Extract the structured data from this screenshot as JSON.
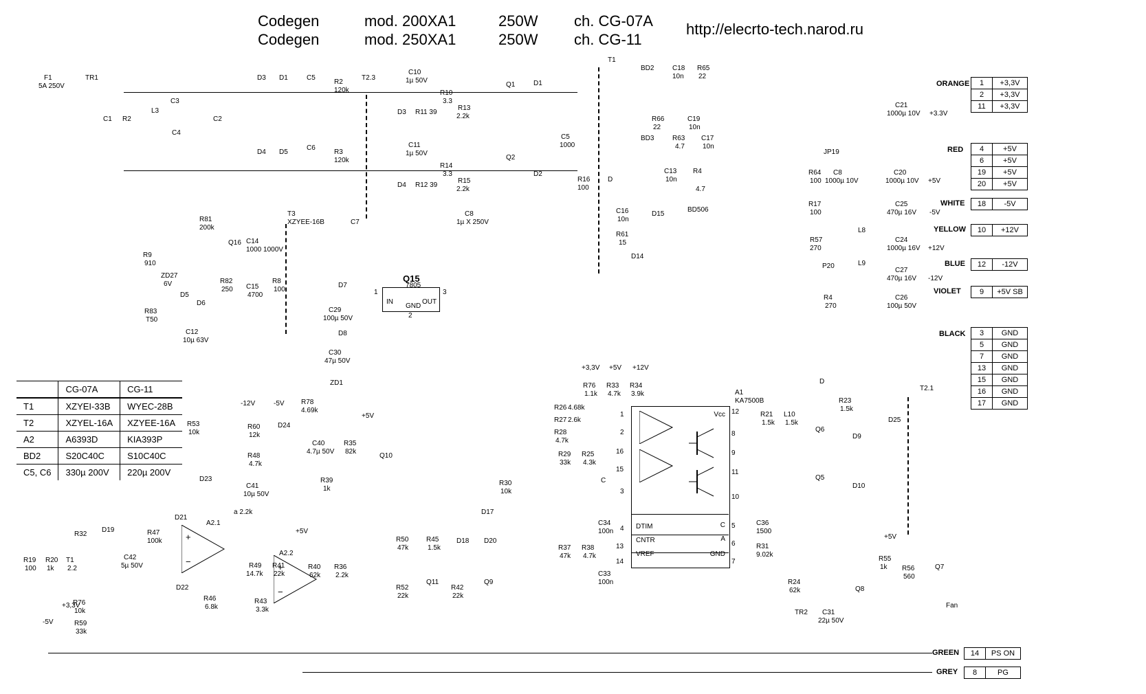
{
  "header": {
    "l1_a": "Codegen",
    "l1_b": "mod. 200XA1",
    "l1_c": "250W",
    "l1_d": "ch. CG-07A",
    "l2_a": "Codegen",
    "l2_b": "mod. 250XA1",
    "l2_c": "250W",
    "l2_d": "ch. CG-11",
    "url": "http://elecrto-tech.narod.ru"
  },
  "outputs": {
    "orange": {
      "label": "ORANGE",
      "pins": [
        {
          "n": "1",
          "v": "+3,3V"
        },
        {
          "n": "2",
          "v": "+3,3V"
        },
        {
          "n": "11",
          "v": "+3,3V"
        }
      ]
    },
    "red": {
      "label": "RED",
      "pins": [
        {
          "n": "4",
          "v": "+5V"
        },
        {
          "n": "6",
          "v": "+5V"
        },
        {
          "n": "19",
          "v": "+5V"
        },
        {
          "n": "20",
          "v": "+5V"
        }
      ]
    },
    "white": {
      "label": "WHITE",
      "pins": [
        {
          "n": "18",
          "v": "-5V"
        }
      ]
    },
    "yellow": {
      "label": "YELLOW",
      "pins": [
        {
          "n": "10",
          "v": "+12V"
        }
      ]
    },
    "blue": {
      "label": "BLUE",
      "pins": [
        {
          "n": "12",
          "v": "-12V"
        }
      ]
    },
    "violet": {
      "label": "VIOLET",
      "pins": [
        {
          "n": "9",
          "v": "+5V SB"
        }
      ]
    },
    "black": {
      "label": "BLACK",
      "pins": [
        {
          "n": "3",
          "v": "GND"
        },
        {
          "n": "5",
          "v": "GND"
        },
        {
          "n": "7",
          "v": "GND"
        },
        {
          "n": "13",
          "v": "GND"
        },
        {
          "n": "15",
          "v": "GND"
        },
        {
          "n": "16",
          "v": "GND"
        },
        {
          "n": "17",
          "v": "GND"
        }
      ]
    },
    "green": {
      "label": "GREEN",
      "pins": [
        {
          "n": "14",
          "v": "PS ON"
        }
      ]
    },
    "grey": {
      "label": "GREY",
      "pins": [
        {
          "n": "8",
          "v": "PG"
        }
      ]
    }
  },
  "variant_table": {
    "cols": [
      "",
      "CG-07A",
      "CG-11"
    ],
    "rows": [
      [
        "T1",
        "XZYEI-33B",
        "WYEC-28B"
      ],
      [
        "T2",
        "XZYEL-16A",
        "XZYEE-16A"
      ],
      [
        "A2",
        "A6393D",
        "KIA393P"
      ],
      [
        "BD2",
        "S20C40C",
        "S10C40C"
      ],
      [
        "C5, C6",
        "330µ 200V",
        "220µ 200V"
      ]
    ]
  },
  "ic": {
    "q15": {
      "name": "Q15",
      "part": "7805",
      "p1": "1",
      "p2": "2",
      "p3": "3",
      "in": "IN",
      "gnd": "GND",
      "out": "OUT"
    },
    "a1": {
      "name": "A1",
      "part": "KA7500B",
      "left": [
        "1",
        "2",
        "16",
        "15",
        "3",
        "4",
        "13",
        "14"
      ],
      "right": [
        "12",
        "8",
        "9",
        "11",
        "10",
        "5",
        "6",
        "7"
      ],
      "labels_left": [
        "DTIM",
        "CNTR",
        "VREF"
      ],
      "labels_right": [
        "Vcc",
        "C",
        "A",
        "GND"
      ]
    },
    "a2_1": "A2.1",
    "a2_2": "A2.2"
  },
  "refs": {
    "F1": "F1",
    "F1v": "5A 250V",
    "TR1": "TR1",
    "L3": "L3",
    "C1": "C1",
    "C2": "C2",
    "C3": "C3",
    "C4": "C4",
    "R2": "R2",
    "D3": "D3",
    "D4": "D4",
    "D1": "D1",
    "D5": "D5",
    "C5": "C5",
    "C6": "C6",
    "R2b": "R2",
    "R2bv": "120k",
    "R3": "R3",
    "R3v": "120k",
    "T23": "T2.3",
    "C10": "C10",
    "C10v": "1µ 50V",
    "D3b": "D3",
    "R11": "R11 39",
    "R10": "R10",
    "R10v": "3.3",
    "R13": "R13",
    "R13v": "2.2k",
    "Q1": "Q1",
    "D1b": "D1",
    "C11": "C11",
    "C11v": "1µ 50V",
    "D4b": "D4",
    "R12": "R12 39",
    "R14": "R14",
    "R14v": "3.3",
    "R15": "R15",
    "R15v": "2.2k",
    "Q2": "Q2",
    "D2": "D2",
    "C5b": "C5",
    "C5bv": "1000",
    "R16": "R16",
    "R16v": "100",
    "C8p": "C8",
    "C8pv": "1µ X 250V",
    "C7": "C7",
    "T1": "T1",
    "BD2": "BD2",
    "C18": "C18",
    "C18v": "10n",
    "R65": "R65",
    "R65v": "22",
    "R66": "R66",
    "R66v": "22",
    "C19": "C19",
    "C19v": "10n",
    "BD3": "BD3",
    "R63": "R63",
    "R63v": "4.7",
    "C17": "C17",
    "C17v": "10n",
    "C13": "C13",
    "C13v": "10n",
    "R4b": "R4",
    "R4bv": "4.7",
    "D": "D",
    "C16": "C16",
    "C16v": "10n",
    "R61": "R61",
    "R61v": "15",
    "D15": "D15",
    "BD506": "BD506",
    "D14": "D14",
    "JP19": "JP19",
    "R64": "R64",
    "R64v": "100",
    "C8": "C8",
    "C8v": "1000µ 10V",
    "C20": "C20",
    "C20v": "1000µ 10V",
    "p5": "+5V",
    "C21": "C21",
    "C21v": "1000µ 10V",
    "p33": "+3.3V",
    "R17": "R17",
    "R17v": "100",
    "C25": "C25",
    "C25v": "470µ 16V",
    "m5": "-5V",
    "L8": "L8",
    "R57": "R57",
    "R57v": "270",
    "C24": "C24",
    "C24v": "1000µ 16V",
    "p12": "+12V",
    "L9": "L9",
    "P20": "P20",
    "C27": "C27",
    "C27v": "470µ 16V",
    "m12": "-12V",
    "R4": "R4",
    "R4v": "270",
    "C26": "C26",
    "C26v": "100µ 50V",
    "T3": "T3",
    "T3v": "XZYEE-16B",
    "R81": "R81",
    "R81v": "200k",
    "R9": "R9",
    "R9v": "910",
    "Q16": "Q16",
    "ZD27": "ZD27",
    "ZD27v": "6V",
    "D5b": "D5",
    "D6": "D6",
    "R82": "R82",
    "R82v": "250",
    "C14": "C14",
    "C14v": "1000 1000V",
    "C15": "C15",
    "C15v": "4700",
    "R8": "R8",
    "R8v": "100",
    "R83": "R83",
    "R83v": "T50",
    "C12": "C12",
    "C12v": "10µ 63V",
    "D7": "D7",
    "C29": "C29",
    "C29v": "100µ 50V",
    "D8": "D8",
    "C30": "C30",
    "C30v": "47µ 50V",
    "ZD1": "ZD1",
    "R78": "R78",
    "R78v": "4.69k",
    "R53": "R53",
    "R53v": "10k",
    "D23": "D23",
    "D21": "D21",
    "D22": "D22",
    "R60": "R60",
    "R60v": "12k",
    "R48": "R48",
    "R48v": "4.7k",
    "C41": "C41",
    "C41v": "10µ 50V",
    "D24": "D24",
    "m12r": "-12V",
    "m5r": "-5V",
    "R47": "R47",
    "R47v": "100k",
    "C42": "C42",
    "C42v": "5µ 50V",
    "R32": "R32",
    "D19": "D19",
    "R19": "R19",
    "R19v": "100",
    "R20": "R20",
    "R20v": "1k",
    "T1b": "T1",
    "T1bv": "2.2",
    "p33r": "+3,3V",
    "m5r2": "-5V",
    "R76": "R76",
    "R76v": "10k",
    "R59": "R59",
    "R59v": "33k",
    "R46": "R46",
    "R46v": "6.8k",
    "a22k": "a 2.2k",
    "R49": "R49",
    "R49v": "14.7k",
    "R41": "R41",
    "R41v": "22k",
    "R43": "R43",
    "R43v": "3.3k",
    "p5c": "+5V",
    "p5d": "+5V",
    "C40": "C40",
    "C40v": "4.7µ 50V",
    "R35": "R35",
    "R35v": "82k",
    "R39": "R39",
    "R39v": "1k",
    "Q10": "Q10",
    "R40": "R40",
    "R40v": "62k",
    "R36": "R36",
    "R36v": "2.2k",
    "R50": "R50",
    "R50v": "47k",
    "R45": "R45",
    "R45v": "1.5k",
    "D18": "D18",
    "D20": "D20",
    "R52": "R52",
    "R52v": "22k",
    "Q11": "Q11",
    "R42": "R42",
    "R42v": "22k",
    "Q9": "Q9",
    "R30": "R30",
    "R30v": "10k",
    "D17": "D17",
    "C34": "C34",
    "C34v": "100n",
    "C33": "C33",
    "C33v": "100n",
    "R37": "R37",
    "R37v": "47k",
    "R38": "R38",
    "R38v": "4.7k",
    "R29": "R29",
    "R29v": "33k",
    "R25": "R25",
    "R25v": "4.3k",
    "C": "C",
    "R26": "R26",
    "R26v": "4.68k",
    "R27": "R27",
    "R27v": "2.6k",
    "R28": "R28",
    "R28v": "4.7k",
    "R76b": "R76",
    "R76bv": "1.1k",
    "R33": "R33",
    "R33v": "4.7k",
    "R34": "R34",
    "R34v": "3.9k",
    "p33t": "+3,3V",
    "p5t": "+5V",
    "p12t": "+12V",
    "R21": "R21",
    "R21v": "1.5k",
    "L10": "L10",
    "L10v": "1.5k",
    "R23": "R23",
    "R23v": "1.5k",
    "Db": "D",
    "Q6": "Q6",
    "Q5": "Q5",
    "D9": "D9",
    "D10": "D10",
    "D25": "D25",
    "T21": "T2.1",
    "C36": "C36",
    "C36v": "1500",
    "R31": "R31",
    "R31v": "9.02k",
    "R24": "R24",
    "R24v": "62k",
    "TR2": "TR2",
    "C31": "C31",
    "C31v": "22µ 50V",
    "Q8": "Q8",
    "R55": "R55",
    "R55v": "1k",
    "R56": "R56",
    "R56v": "560",
    "Q7": "Q7",
    "Fan": "Fan",
    "p5e": "+5V",
    "A1pins": "."
  }
}
